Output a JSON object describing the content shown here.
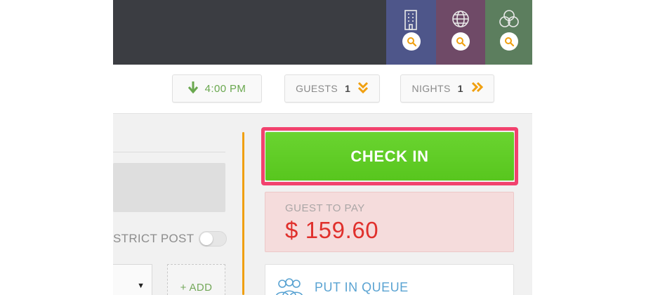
{
  "header": {
    "categories": [
      {
        "name": "hotel",
        "icon": "hotel-building-icon",
        "color": "#4e568a"
      },
      {
        "name": "globe",
        "icon": "globe-icon",
        "color": "#6f4a67"
      },
      {
        "name": "rings",
        "icon": "rings-icon",
        "color": "#5c7e5e"
      }
    ],
    "badge_icon": "search-icon"
  },
  "filters": {
    "time": {
      "icon": "arrow-down-icon",
      "value": "4:00 PM"
    },
    "guests": {
      "label": "GUESTS",
      "value": "1",
      "icon": "double-chevron-down-icon"
    },
    "nights": {
      "label": "NIGHTS",
      "value": "1",
      "icon": "double-chevron-right-icon"
    }
  },
  "left_panel": {
    "strict_label": "STRICT POST",
    "strict_enabled": false,
    "add_label": "+ ADD"
  },
  "actions": {
    "checkin_label": "CHECK IN"
  },
  "payment": {
    "label": "GUEST TO PAY",
    "amount": "$ 159.60"
  },
  "queue": {
    "label": "PUT IN QUEUE",
    "icon": "people-group-icon"
  },
  "colors": {
    "accent_green": "#5ccb22",
    "highlight": "#f2426e",
    "amount_red": "#e0302c",
    "queue_blue": "#5aa3d2",
    "bar_orange": "#f0a010"
  }
}
